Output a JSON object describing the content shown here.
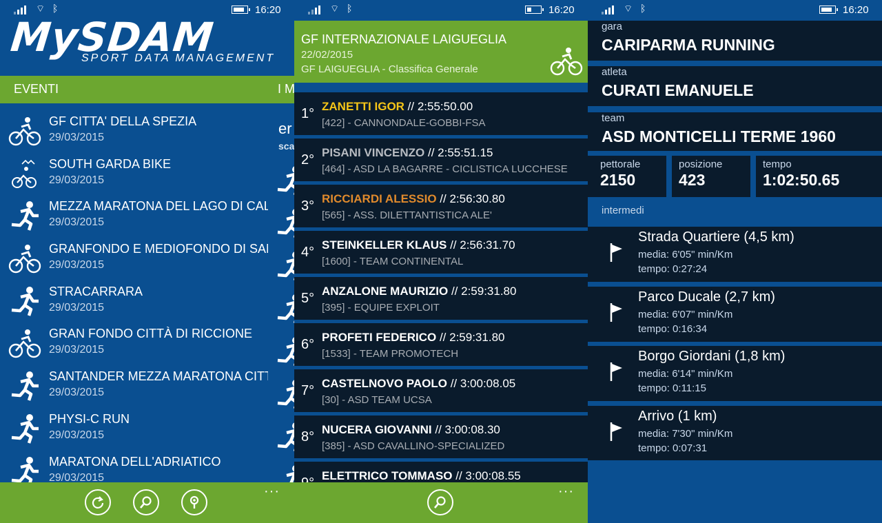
{
  "status": {
    "time": "16:20"
  },
  "screen1": {
    "logo": {
      "brand": "MySDAM",
      "tagline": "SPORT DATA MANAGEMENT"
    },
    "pivot": {
      "active": "EVENTI",
      "next": "I M"
    },
    "events": [
      {
        "name": "GF CITTA' DELLA SPEZIA",
        "date": "29/03/2015",
        "icon": "bike-icon"
      },
      {
        "name": "SOUTH GARDA BIKE",
        "date": "29/03/2015",
        "icon": "mtb-icon"
      },
      {
        "name": "MEZZA MARATONA DEL LAGO DI CAL",
        "date": "29/03/2015",
        "icon": "runner-icon"
      },
      {
        "name": "GRANFONDO E MEDIOFONDO DI SAN",
        "date": "29/03/2015",
        "icon": "bike-icon"
      },
      {
        "name": "STRACARRARA",
        "date": "29/03/2015",
        "icon": "runner-icon"
      },
      {
        "name": "GRAN FONDO CITTÀ DI RICCIONE",
        "date": "29/03/2015",
        "icon": "bike-icon"
      },
      {
        "name": "SANTANDER MEZZA MARATONA CITT",
        "date": "29/03/2015",
        "icon": "runner-icon"
      },
      {
        "name": "PHYSI-C RUN",
        "date": "29/03/2015",
        "icon": "runner-icon"
      },
      {
        "name": "MARATONA DELL'ADRIATICO",
        "date": "29/03/2015",
        "icon": "runner-icon"
      }
    ],
    "peek": {
      "title": "er",
      "sub": "sca"
    },
    "appbar": {
      "more": "···"
    }
  },
  "screen2": {
    "title": "GF INTERNAZIONALE LAIGUEGLIA",
    "date": "22/02/2015",
    "subtitle": "GF LAIGUEGLIA - Classifica Generale",
    "results": [
      {
        "pos": "1°",
        "name": "ZANETTI IGOR",
        "time": " // 2:55:50.00",
        "sub": "[422] - CANNONDALE-GOBBI-FSA",
        "color": "#f5c518"
      },
      {
        "pos": "2°",
        "name": "PISANI VINCENZO",
        "time": " // 2:55:51.15",
        "sub": "[464] - ASD LA BAGARRE - CICLISTICA LUCCHESE",
        "color": "#b8bcc2"
      },
      {
        "pos": "3°",
        "name": "RICCIARDI ALESSIO",
        "time": " // 2:56:30.80",
        "sub": "[565] - ASS. DILETTANTISTICA ALE'",
        "color": "#e08a2c"
      },
      {
        "pos": "4°",
        "name": "STEINKELLER KLAUS",
        "time": " // 2:56:31.70",
        "sub": "[1600] - TEAM CONTINENTAL",
        "color": "#ffffff"
      },
      {
        "pos": "5°",
        "name": "ANZALONE MAURIZIO",
        "time": " // 2:59:31.80",
        "sub": "[395] - EQUIPE EXPLOIT",
        "color": "#ffffff"
      },
      {
        "pos": "6°",
        "name": "PROFETI FEDERICO",
        "time": " // 2:59:31.80",
        "sub": "[1533] - TEAM PROMOTECH",
        "color": "#ffffff"
      },
      {
        "pos": "7°",
        "name": "CASTELNOVO PAOLO",
        "time": " // 3:00:08.05",
        "sub": "[30] - ASD TEAM UCSA",
        "color": "#ffffff"
      },
      {
        "pos": "8°",
        "name": "NUCERA GIOVANNI",
        "time": " // 3:00:08.30",
        "sub": "[385] - ASD CAVALLINO-SPECIALIZED",
        "color": "#ffffff"
      },
      {
        "pos": "9°",
        "name": "ELETTRICO TOMMASO",
        "time": " // 3:00:08.55",
        "sub": "",
        "color": "#ffffff"
      }
    ],
    "appbar": {
      "more": "···"
    }
  },
  "screen3": {
    "gara_label": "gara",
    "gara": "CARIPARMA RUNNING",
    "atleta_label": "atleta",
    "atleta": "CURATI EMANUELE",
    "team_label": "team",
    "team": "ASD MONTICELLI TERME 1960",
    "pettorale_label": "pettorale",
    "pettorale": "2150",
    "posizione_label": "posizione",
    "posizione": "423",
    "tempo_label": "tempo",
    "tempo": "1:02:50.65",
    "intermedi_label": "intermedi",
    "splits": [
      {
        "name": "Strada Quartiere (4,5 km)",
        "media": "media: 6'05\" min/Km",
        "tempo": "tempo: 0:27:24"
      },
      {
        "name": "Parco Ducale (2,7 km)",
        "media": "media: 6'07\" min/Km",
        "tempo": "tempo: 0:16:34"
      },
      {
        "name": "Borgo Giordani (1,8 km)",
        "media": "media: 6'14\" min/Km",
        "tempo": "tempo: 0:11:15"
      },
      {
        "name": "Arrivo (1 km)",
        "media": "media: 7'30\" min/Km",
        "tempo": "tempo: 0:07:31"
      }
    ]
  },
  "colors": {
    "blue": "#0a4f91",
    "green": "#6ca730",
    "dark": "#0a1b2c",
    "gold": "#f5c518",
    "silver": "#b8bcc2",
    "bronze": "#e08a2c"
  }
}
